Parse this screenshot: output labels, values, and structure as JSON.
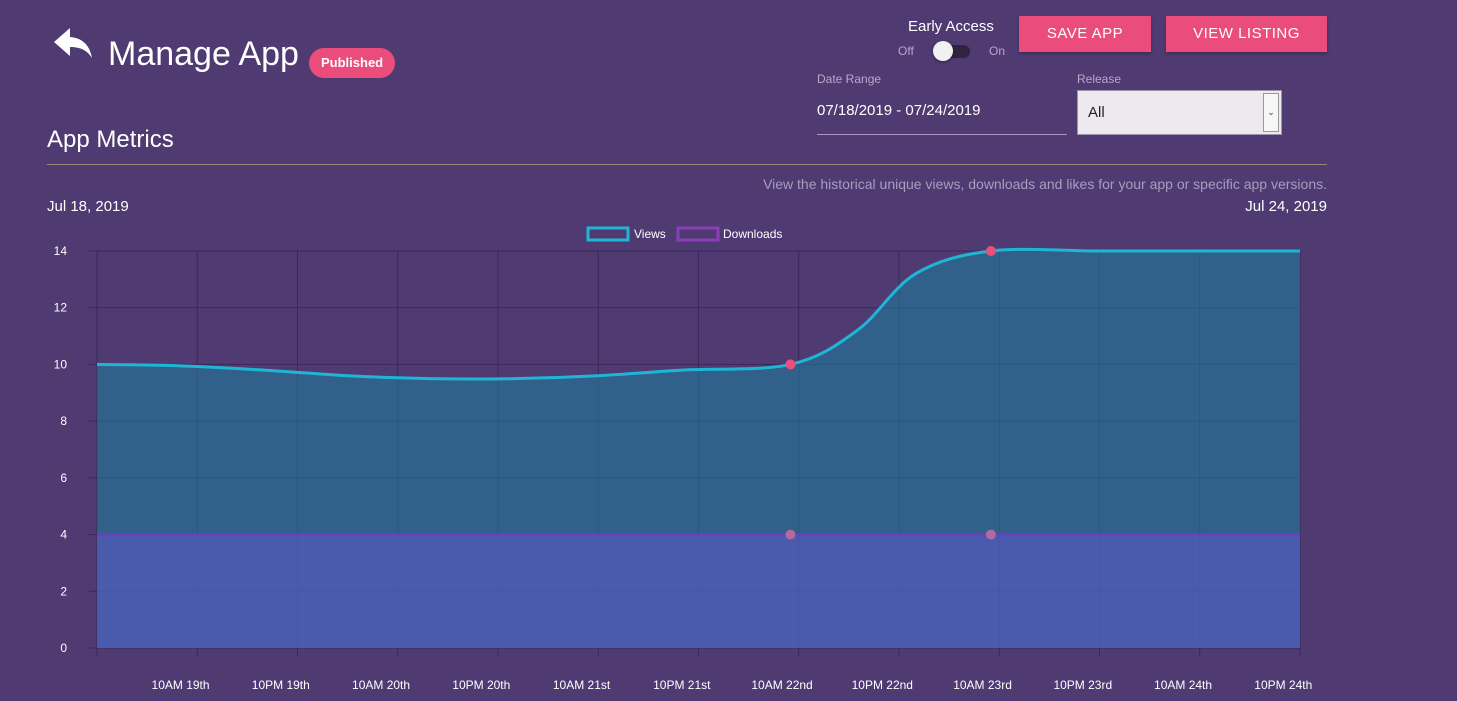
{
  "header": {
    "title": "Manage App",
    "status_badge": "Published",
    "back_icon": "back-arrow-icon"
  },
  "early_access": {
    "label": "Early Access",
    "off_label": "Off",
    "on_label": "On",
    "enabled": false
  },
  "actions": {
    "save_label": "SAVE APP",
    "view_listing_label": "VIEW LISTING"
  },
  "filters": {
    "date_range_label": "Date Range",
    "date_range_value": "07/18/2019 - 07/24/2019",
    "release_label": "Release",
    "release_value": "All"
  },
  "metrics": {
    "title": "App Metrics",
    "description": "View the historical unique views, downloads and likes for your app or specific app versions.",
    "start_date": "Jul 18, 2019",
    "end_date": "Jul 24, 2019"
  },
  "colors": {
    "background": "#4f3a72",
    "accent": "#ea4c7c",
    "views": "#1fb6d6",
    "downloads": "#8a3fb8"
  },
  "chart_data": {
    "type": "area",
    "x_tick_labels": [
      "10AM 19th",
      "10PM 19th",
      "10AM 20th",
      "10PM 20th",
      "10AM 21st",
      "10PM 21st",
      "10AM 22nd",
      "10PM 22nd",
      "10AM 23rd",
      "10PM 23rd",
      "10AM 24th",
      "10PM 24th"
    ],
    "ylim": [
      0,
      14
    ],
    "y_ticks": [
      0,
      2,
      4,
      6,
      8,
      10,
      12,
      14
    ],
    "grid": true,
    "legend_position": "top",
    "series": [
      {
        "name": "Views",
        "hours": [
          0,
          10,
          20,
          30,
          40,
          50,
          60,
          70,
          83,
          91,
          98,
          107,
          120,
          130,
          144
        ],
        "values": [
          10,
          9.95,
          9.8,
          9.6,
          9.5,
          9.5,
          9.6,
          9.8,
          10,
          11.2,
          13.2,
          14,
          14,
          14,
          14
        ],
        "marker_hours": [
          83,
          107
        ],
        "marker_values": [
          10,
          14
        ]
      },
      {
        "name": "Downloads",
        "hours": [
          0,
          144
        ],
        "values": [
          4,
          4
        ],
        "marker_hours": [
          83,
          107
        ],
        "marker_values": [
          4,
          4
        ]
      }
    ]
  }
}
